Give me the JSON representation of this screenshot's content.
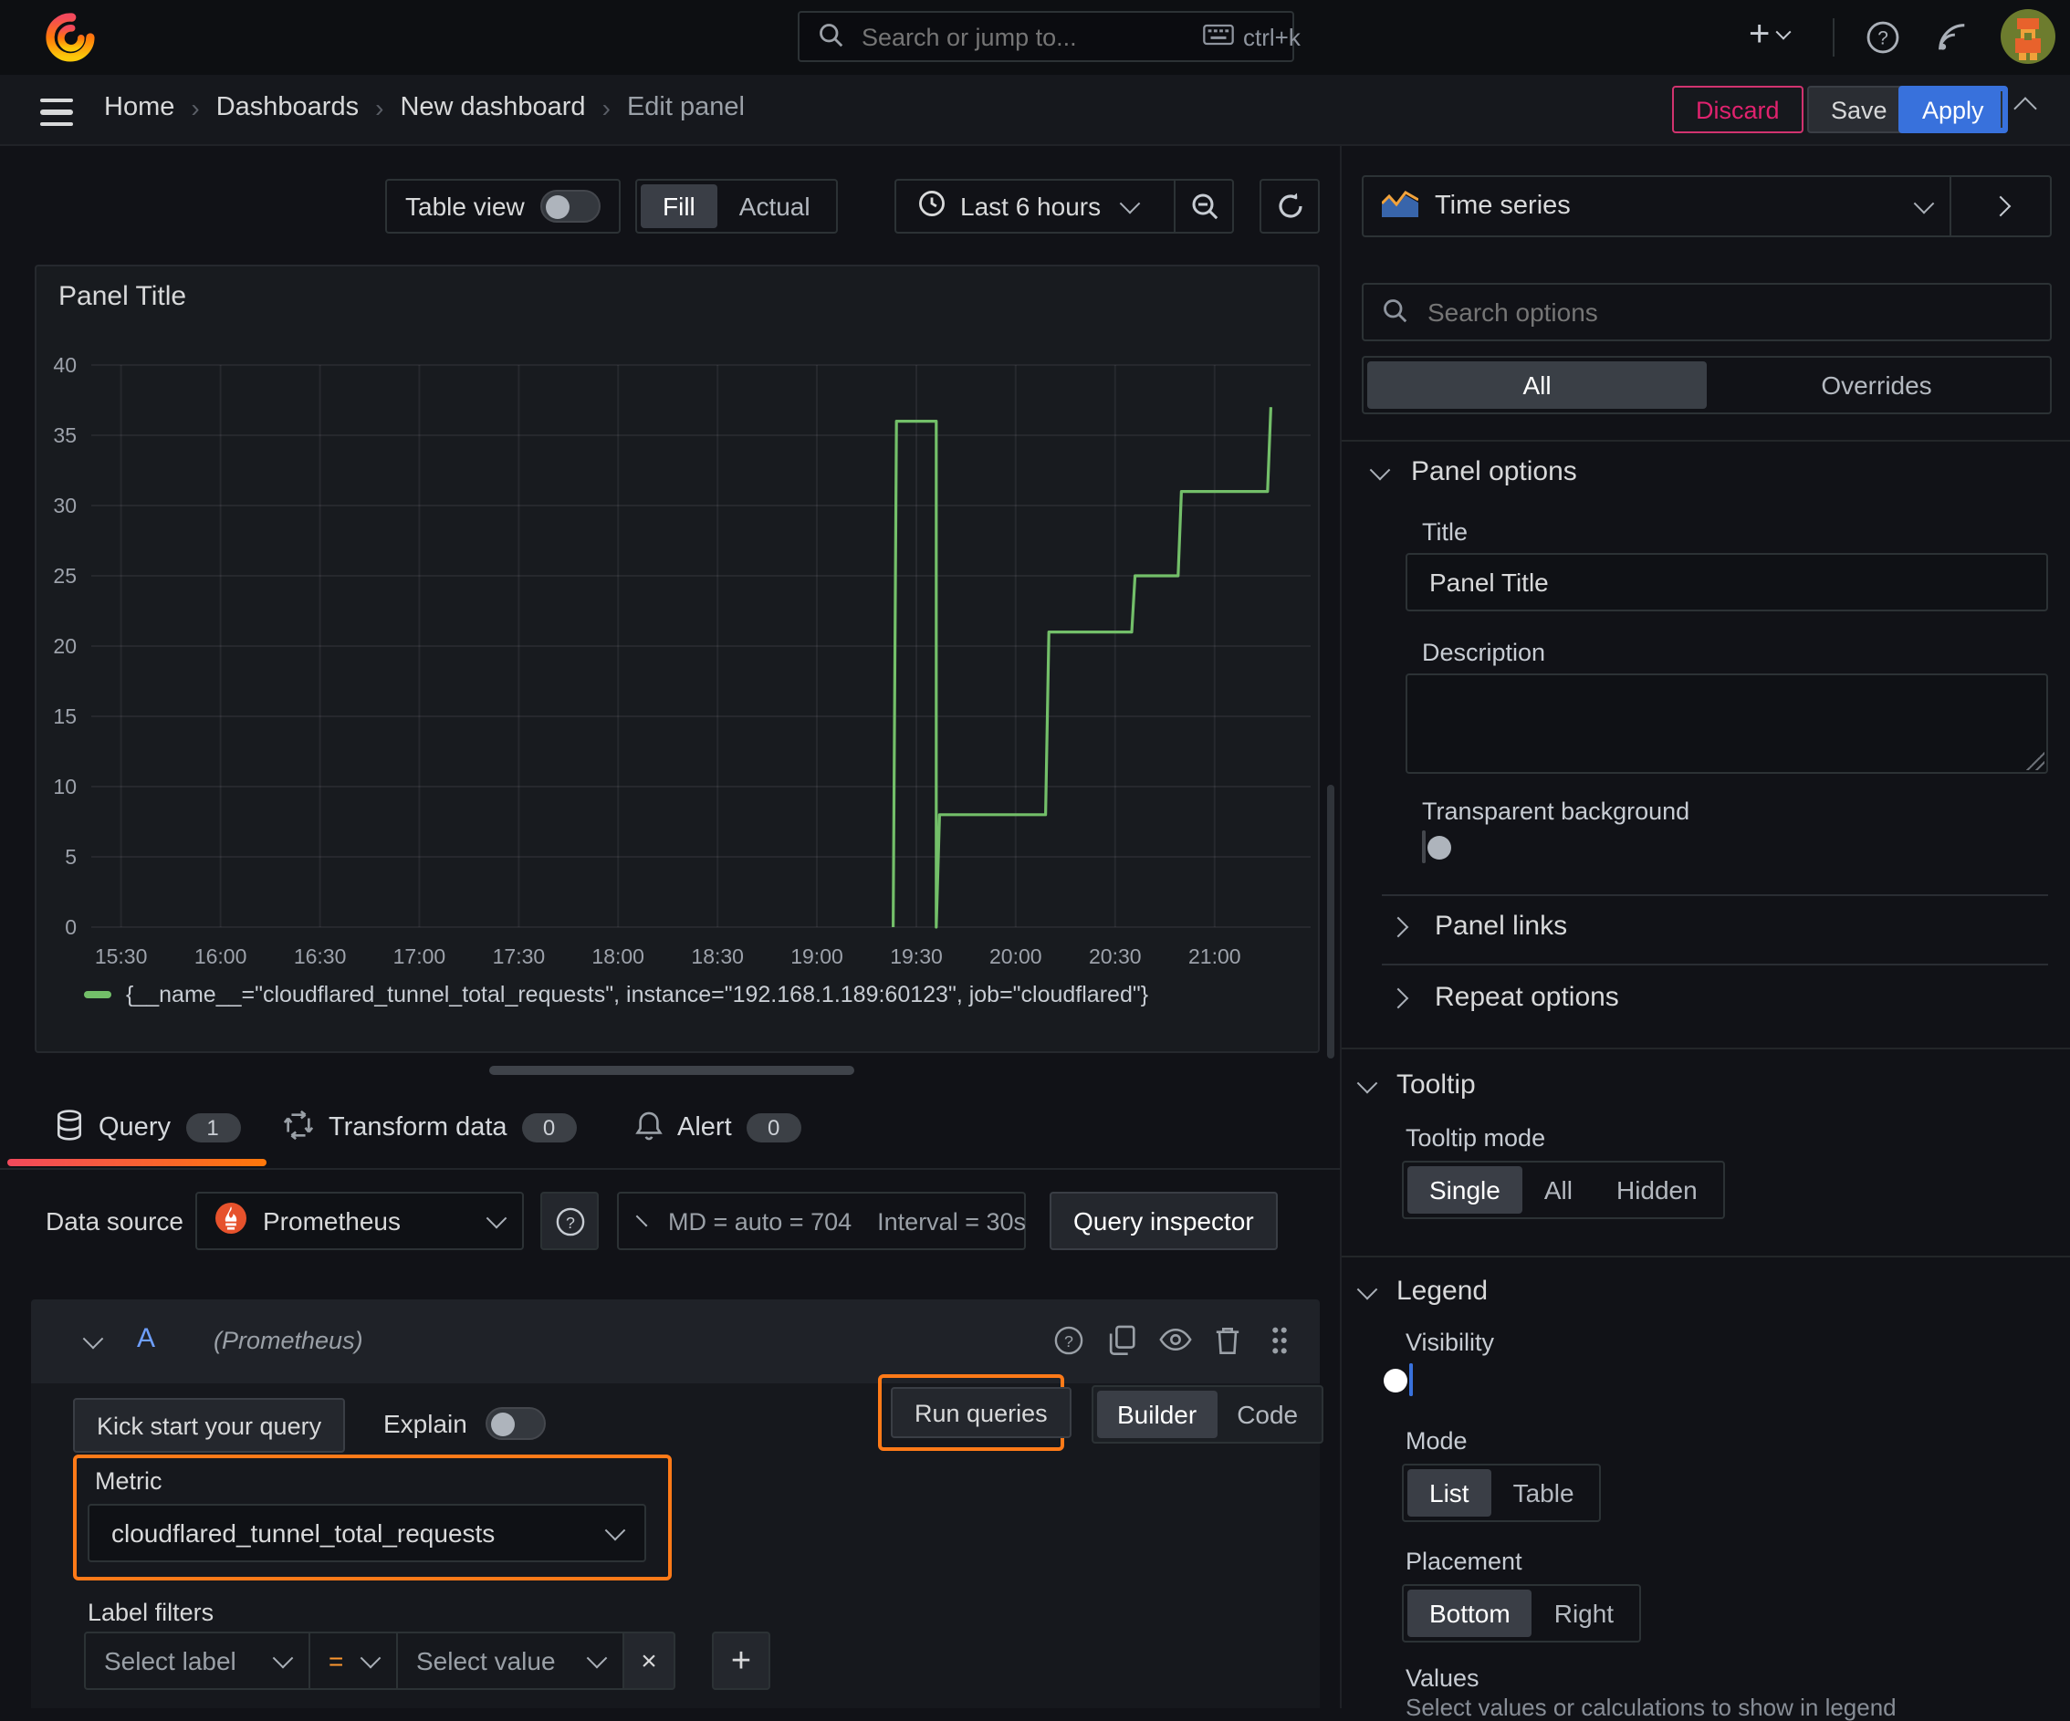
{
  "topbar": {
    "search_placeholder": "Search or jump to...",
    "search_shortcut": "ctrl+k"
  },
  "breadcrumb": {
    "items": [
      "Home",
      "Dashboards",
      "New dashboard",
      "Edit panel"
    ]
  },
  "header_actions": {
    "discard": "Discard",
    "save": "Save",
    "apply": "Apply"
  },
  "view_toolbar": {
    "table_view_label": "Table view",
    "fill_label": "Fill",
    "actual_label": "Actual",
    "time_range_label": "Last 6 hours"
  },
  "panel": {
    "title": "Panel Title"
  },
  "chart_data": {
    "type": "line",
    "title": "Panel Title",
    "line_color": "#73bf69",
    "grid": true,
    "legend_position": "bottom",
    "ylim": [
      0,
      40
    ],
    "y_ticks": [
      0,
      5,
      10,
      15,
      20,
      25,
      30,
      35,
      40
    ],
    "x_domain": [
      "15:21",
      "21:29"
    ],
    "x_ticks": [
      "15:30",
      "16:00",
      "16:30",
      "17:00",
      "17:30",
      "18:00",
      "18:30",
      "19:00",
      "19:30",
      "20:00",
      "20:30",
      "21:00"
    ],
    "series": [
      {
        "name": "{__name__=\"cloudflared_tunnel_total_requests\", instance=\"192.168.1.189:60123\", job=\"cloudflared\"}",
        "step_points": [
          [
            "19:23",
            0
          ],
          [
            "19:24",
            36
          ],
          [
            "19:36",
            36
          ],
          [
            "19:36",
            0
          ],
          [
            "19:37",
            8
          ],
          [
            "20:09",
            8
          ],
          [
            "20:10",
            21
          ],
          [
            "20:35",
            21
          ],
          [
            "20:36",
            25
          ],
          [
            "20:49",
            25
          ],
          [
            "20:50",
            31
          ],
          [
            "21:16",
            31
          ],
          [
            "21:17",
            37
          ]
        ]
      }
    ]
  },
  "query_tabs": {
    "query": {
      "label": "Query",
      "count": "1"
    },
    "transform": {
      "label": "Transform data",
      "count": "0"
    },
    "alert": {
      "label": "Alert",
      "count": "0"
    }
  },
  "datasource_bar": {
    "label": "Data source",
    "value": "Prometheus",
    "md_text": "MD = auto = 704",
    "interval_text": "Interval = 30s",
    "inspector_label": "Query inspector"
  },
  "query_editor": {
    "ref_id": "A",
    "datasource_hint": "(Prometheus)",
    "kick_start_label": "Kick start your query",
    "explain_label": "Explain",
    "run_queries_label": "Run queries",
    "builder_label": "Builder",
    "code_label": "Code",
    "metric": {
      "label": "Metric",
      "value": "cloudflared_tunnel_total_requests"
    },
    "label_filters": {
      "label": "Label filters",
      "select_label_placeholder": "Select label",
      "operator": "=",
      "select_value_placeholder": "Select value"
    }
  },
  "sidebar": {
    "visualization": "Time series",
    "search_placeholder": "Search options",
    "tabs": {
      "all": "All",
      "overrides": "Overrides"
    },
    "panel_options": {
      "heading": "Panel options",
      "title_label": "Title",
      "title_value": "Panel Title",
      "description_label": "Description",
      "transparent_label": "Transparent background"
    },
    "collapsed": {
      "panel_links": "Panel links",
      "repeat_options": "Repeat options"
    },
    "tooltip": {
      "heading": "Tooltip",
      "mode_label": "Tooltip mode",
      "options": [
        "Single",
        "All",
        "Hidden"
      ],
      "selected": "Single"
    },
    "legend": {
      "heading": "Legend",
      "visibility_label": "Visibility",
      "mode_label": "Mode",
      "mode_options": [
        "List",
        "Table"
      ],
      "mode_selected": "List",
      "placement_label": "Placement",
      "placement_options": [
        "Bottom",
        "Right"
      ],
      "placement_selected": "Bottom",
      "values_label": "Values",
      "values_hint": "Select values or calculations to show in legend"
    }
  },
  "colors": {
    "accent_blue": "#3871dc",
    "annotation_orange": "#ff7a18",
    "discard_pink": "#e0226e",
    "series_green": "#73bf69"
  }
}
